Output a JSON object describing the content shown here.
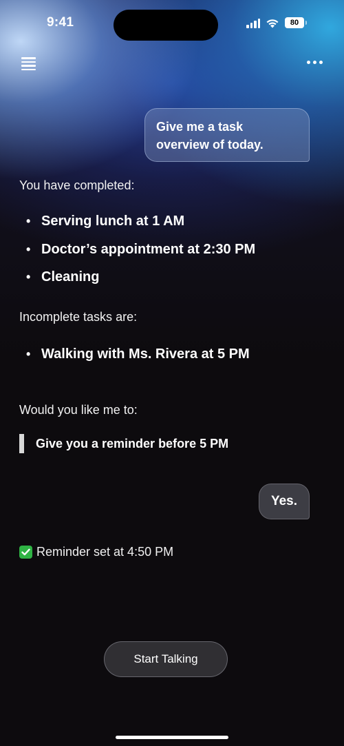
{
  "status_bar": {
    "time": "9:41",
    "battery": "80",
    "icons": [
      "signal-icon",
      "wifi-icon",
      "battery-icon"
    ]
  },
  "nav": {
    "menu_icon": "menu-icon",
    "more_icon": "more-icon"
  },
  "chat": {
    "user_message_1": "Give me a task overview of today.",
    "completed_intro": "You have completed:",
    "completed_tasks": [
      "Serving lunch at 1 AM",
      "Doctor’s appointment at 2:30 PM",
      "Cleaning"
    ],
    "incomplete_intro": "Incomplete tasks are:",
    "incomplete_tasks": [
      "Walking with Ms. Rivera at 5 PM"
    ],
    "question": "Would you like me to:",
    "suggestion": "Give you a reminder before 5 PM",
    "user_message_2": "Yes.",
    "confirmation": "Reminder set at 4:50 PM"
  },
  "actions": {
    "talk_label": "Start Talking"
  },
  "colors": {
    "background": "#0d0b0e",
    "check_green": "#2fb344"
  }
}
